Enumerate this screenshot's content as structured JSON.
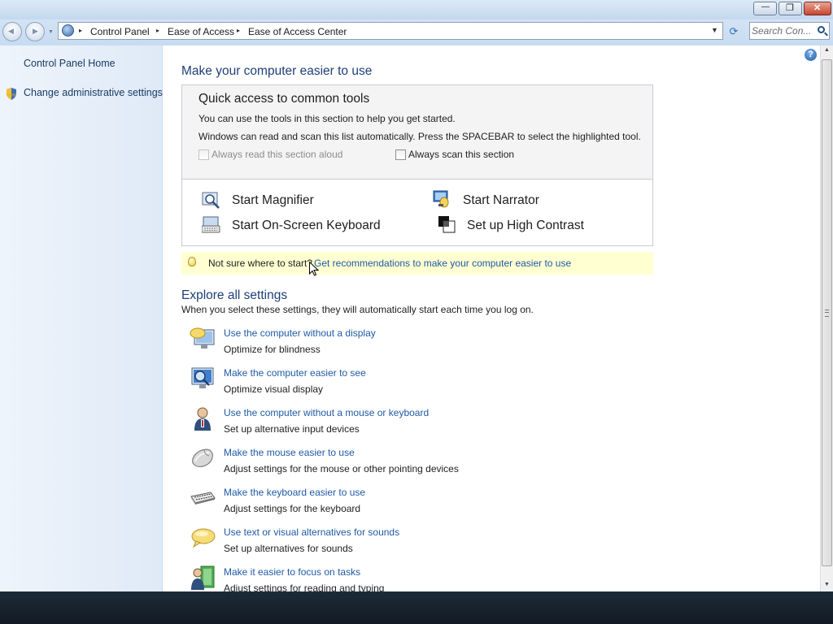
{
  "window": {
    "minimize_glyph": "—",
    "maximize_glyph": "❐",
    "close_glyph": "✕"
  },
  "nav": {
    "back_glyph": "◀",
    "forward_glyph": "▶",
    "recent_glyph": "▼"
  },
  "address": {
    "breadcrumbs": [
      "Control Panel",
      "Ease of Access",
      "Ease of Access Center"
    ],
    "separator_glyph": "▸",
    "dropdown_glyph": "▼",
    "refresh_glyph": "⟳"
  },
  "search": {
    "placeholder": "Search Con..."
  },
  "sidebar": {
    "items": [
      {
        "label": "Control Panel Home"
      },
      {
        "label": "Change administrative settings",
        "icon": "shield-icon"
      }
    ]
  },
  "help": {
    "glyph": "?"
  },
  "main": {
    "title": "Make your computer easier to use",
    "quick_access": {
      "heading": "Quick access to common tools",
      "line1": "You can use the tools in this section to help you get started.",
      "line2": "Windows can read and scan this list automatically.  Press the SPACEBAR to select the highlighted tool.",
      "options": [
        {
          "label": "Always read this section aloud",
          "checked": false,
          "enabled": false
        },
        {
          "label": "Always scan this section",
          "checked": false,
          "enabled": true
        }
      ],
      "tools": [
        {
          "label": "Start Magnifier",
          "icon": "magnifier-icon"
        },
        {
          "label": "Start Narrator",
          "icon": "narrator-icon"
        },
        {
          "label": "Start On-Screen Keyboard",
          "icon": "onscreen-keyboard-icon"
        },
        {
          "label": "Set up High Contrast",
          "icon": "high-contrast-icon"
        }
      ]
    },
    "tip": {
      "text": "Not sure where to start?",
      "link": "Get recommendations to make your computer easier to use"
    },
    "explore": {
      "title": "Explore all settings",
      "description": "When you select these settings, they will automatically start each time you log on.",
      "items": [
        {
          "link": "Use the computer without a display",
          "desc": "Optimize for blindness",
          "icon": "no-display-icon"
        },
        {
          "link": "Make the computer easier to see",
          "desc": "Optimize visual display",
          "icon": "display-icon"
        },
        {
          "link": "Use the computer without a mouse or keyboard",
          "desc": "Set up alternative input devices",
          "icon": "user-icon"
        },
        {
          "link": "Make the mouse easier to use",
          "desc": "Adjust settings for the mouse or other pointing devices",
          "icon": "mouse-icon"
        },
        {
          "link": "Make the keyboard easier to use",
          "desc": "Adjust settings for the keyboard",
          "icon": "keyboard-icon"
        },
        {
          "link": "Use text or visual alternatives for sounds",
          "desc": "Set up alternatives for sounds",
          "icon": "speech-bubble-icon"
        },
        {
          "link": "Make it easier to focus on tasks",
          "desc": "Adjust settings for reading and typing",
          "icon": "focus-tasks-icon"
        }
      ]
    }
  },
  "scrollbar": {
    "up_glyph": "▲",
    "down_glyph": "▼"
  },
  "colors": {
    "link": "#1f5aa4",
    "heading": "#1e3f78",
    "tip_background": "#ffffd2",
    "sidebar_background": "#e7f0fa"
  }
}
